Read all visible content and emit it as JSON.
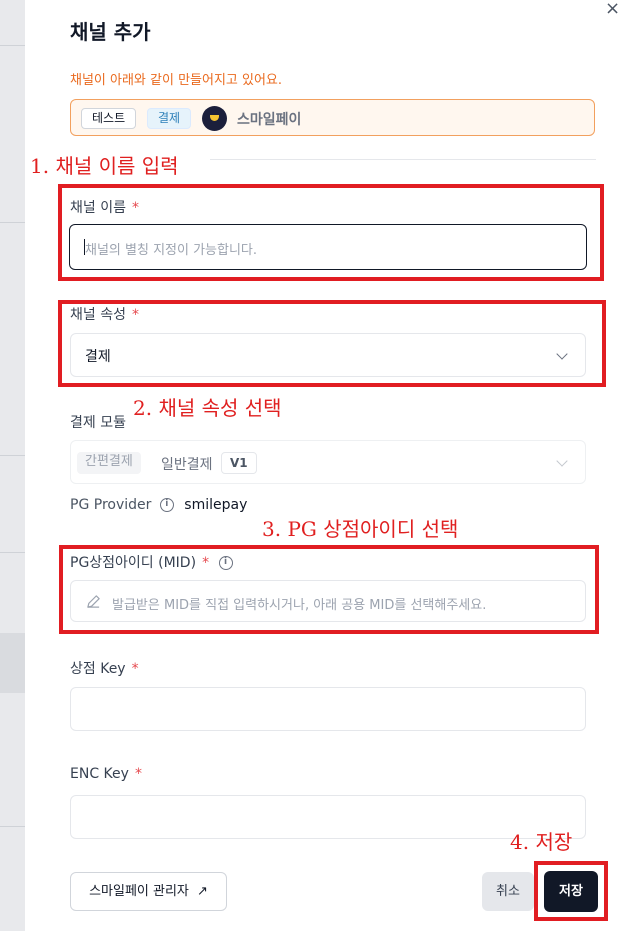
{
  "dialog": {
    "title": "채널 추가",
    "close_symbol": "×",
    "notice": "채널이 아래와 같이 만들어지고 있어요.",
    "preview": {
      "env_chip": "테스트",
      "type_chip": "결제",
      "provider_name": "스마일페이"
    }
  },
  "annotations": {
    "step1": "1. 채널 이름 입력",
    "step2": "2. 채널 속성 선택",
    "step3": "3. PG 상점아이디 선택",
    "step4": "4. 저장"
  },
  "form": {
    "channel_name": {
      "label": "채널 이름",
      "required_mark": "*",
      "placeholder": "채널의 별칭 지정이 가능합니다.",
      "value": ""
    },
    "channel_type": {
      "label": "채널 속성",
      "required_mark": "*",
      "selected": "결제"
    },
    "payment_module": {
      "label": "결제 모듈",
      "easy_pay_tag": "간편결제",
      "general_pay": "일반결제",
      "version_tag": "V1"
    },
    "pg_provider": {
      "label": "PG Provider",
      "value": "smilepay"
    },
    "mid": {
      "label": "PG상점아이디 (MID)",
      "required_mark": "*",
      "placeholder": "발급받은 MID를 직접 입력하시거나, 아래 공용 MID를 선택해주세요."
    },
    "store_key": {
      "label": "상점 Key",
      "required_mark": "*",
      "value": ""
    },
    "enc_key": {
      "label": "ENC Key",
      "required_mark": "*",
      "value": ""
    }
  },
  "footer": {
    "admin_link": "스마일페이 관리자",
    "admin_link_arrow": "↗",
    "cancel": "취소",
    "save": "저장"
  },
  "icons": [
    "close-icon",
    "smilepay-logo",
    "info-icon",
    "chevron-down-icon",
    "pencil-icon",
    "external-link-icon"
  ],
  "colors": {
    "accent_orange": "#ea6a1e",
    "annotation_red": "#e11d22",
    "primary_dark": "#111827"
  }
}
